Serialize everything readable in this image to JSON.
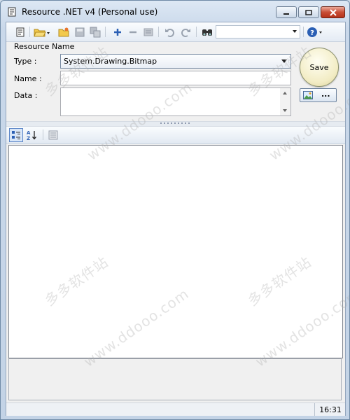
{
  "window": {
    "title": "Resource .NET v4 (Personal use)"
  },
  "icons": {
    "app": "resource-app-icon",
    "toolbar": [
      "new-icon",
      "open-icon",
      "open-folder-icon",
      "save-disk-icon",
      "save-copy-icon",
      "add-icon",
      "remove-icon",
      "rename-icon",
      "undo-icon",
      "redo-icon",
      "find-icon",
      "help-icon"
    ]
  },
  "form": {
    "section_title": "Resource Name",
    "type_label": "Type :",
    "type_value": "System.Drawing.Bitmap",
    "name_label": "Name :",
    "name_value": "",
    "data_label": "Data :",
    "data_value": "",
    "save_label": "Save",
    "browse_label": "..."
  },
  "search": {
    "value": ""
  },
  "statusbar": {
    "time": "16:31"
  },
  "watermark": {
    "domain": "www.ddooo.com",
    "cn": "多多软件站"
  },
  "colors": {
    "accent": "#2b5fb4",
    "save_gold": "#efe7bd",
    "close_red": "#c84d35"
  }
}
